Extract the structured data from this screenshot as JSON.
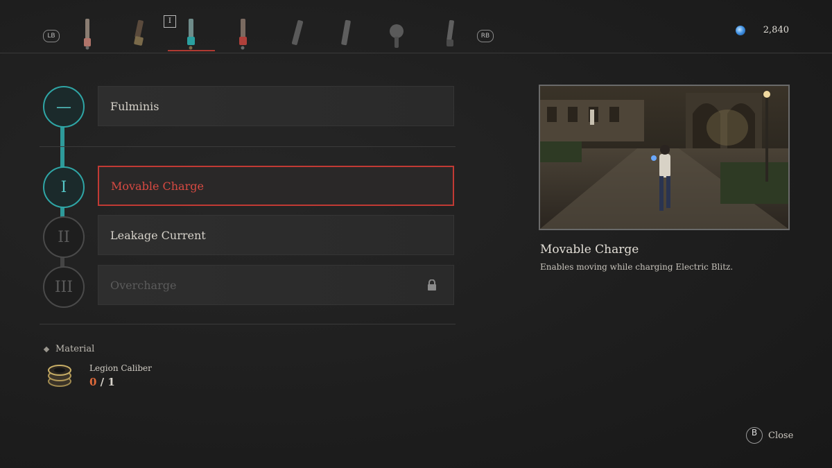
{
  "topbar": {
    "left_bumper": "LB",
    "right_bumper": "RB",
    "selected_tag": "I",
    "currency_amount": "2,840",
    "arms": [
      {
        "name": "arm-1-icon",
        "selected": false
      },
      {
        "name": "arm-2-icon",
        "selected": false
      },
      {
        "name": "arm-3-icon",
        "selected": true
      },
      {
        "name": "arm-4-icon",
        "selected": false
      },
      {
        "name": "arm-5-icon",
        "selected": false
      },
      {
        "name": "arm-6-icon",
        "selected": false
      },
      {
        "name": "arm-7-icon",
        "selected": false
      },
      {
        "name": "arm-8-icon",
        "selected": false
      }
    ]
  },
  "tree": {
    "nodes": [
      {
        "label": "—",
        "state": "active"
      },
      {
        "label": "I",
        "state": "active"
      },
      {
        "label": "II",
        "state": "inactive"
      },
      {
        "label": "III",
        "state": "inactive"
      }
    ]
  },
  "skills": [
    {
      "label": "Fulminis",
      "state": "normal"
    },
    {
      "label": "Movable Charge",
      "state": "selected"
    },
    {
      "label": "Leakage Current",
      "state": "normal"
    },
    {
      "label": "Overcharge",
      "state": "locked"
    }
  ],
  "material": {
    "heading": "Material",
    "name": "Legion Caliber",
    "have": "0",
    "separator": " / ",
    "need": "1"
  },
  "preview": {
    "title": "Movable Charge",
    "description": "Enables moving while charging Electric Blitz."
  },
  "footer": {
    "button": "B",
    "label": "Close"
  },
  "colors": {
    "accent_red": "#c23a34",
    "teal": "#2fa6a6",
    "count_orange": "#e06a3a"
  }
}
